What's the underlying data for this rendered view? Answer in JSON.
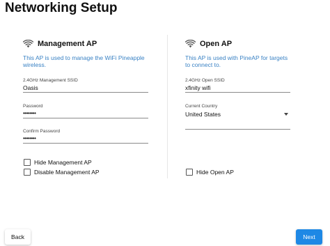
{
  "page": {
    "title": "Networking Setup"
  },
  "management_ap": {
    "heading": "Management AP",
    "description": "This AP is used to manage the WiFi Pineapple wireless.",
    "ssid_label": "2.4GHz Management SSID",
    "ssid_value": "Oasis",
    "password_label": "Password",
    "password_value": "••••••••",
    "confirm_label": "Confirm Password",
    "confirm_value": "••••••••",
    "hide_label": "Hide Management AP",
    "hide_checked": false,
    "disable_label": "Disable Management AP",
    "disable_checked": false
  },
  "open_ap": {
    "heading": "Open AP",
    "description": "This AP is used with PineAP for targets to connect to.",
    "ssid_label": "2.4GHz Open SSID",
    "ssid_value": "xfinity wifi",
    "country_label": "Current Country",
    "country_value": "United States",
    "hide_label": "Hide Open AP",
    "hide_checked": false
  },
  "footer": {
    "back_label": "Back",
    "next_label": "Next"
  },
  "colors": {
    "accent": "#1e88e5",
    "description": "#3a82c4"
  },
  "icons": {
    "ap_heading": "wifi-icon",
    "country_select": "caret-down-icon"
  }
}
